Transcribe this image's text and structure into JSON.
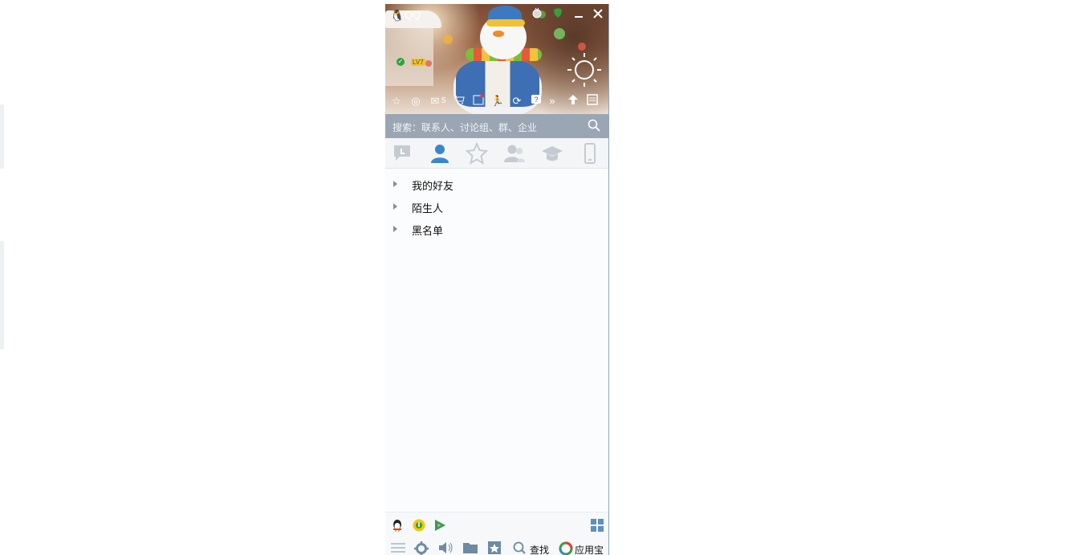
{
  "window": {
    "app_name": "QQ",
    "level_badge": "LV7"
  },
  "toolbar": {
    "mail_count": "5"
  },
  "search": {
    "placeholder": "搜索：联系人、讨论组、群、企业"
  },
  "tabs": [
    {
      "id": "conversations",
      "icon": "chat-bubble-icon"
    },
    {
      "id": "contacts",
      "icon": "person-icon",
      "active": true
    },
    {
      "id": "favorites",
      "icon": "star-icon"
    },
    {
      "id": "groups",
      "icon": "group-icon"
    },
    {
      "id": "education",
      "icon": "graduation-cap-icon"
    },
    {
      "id": "phone",
      "icon": "phone-icon"
    }
  ],
  "groups": [
    {
      "label": "我的好友"
    },
    {
      "label": "陌生人"
    },
    {
      "label": "黑名单"
    }
  ],
  "bottom": {
    "find_label": "查找",
    "appstore_label": "应用宝"
  },
  "colors": {
    "accent_blue": "#3a87c8",
    "status_online": "#2ea33b",
    "search_bar": "#9aa6b3"
  }
}
